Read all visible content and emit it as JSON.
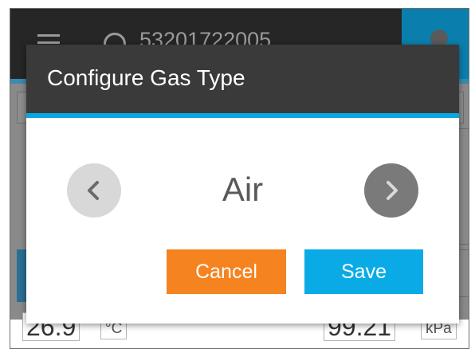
{
  "background": {
    "header": {
      "serial": "53201722005",
      "menu_icon": "hamburger-menu-icon",
      "info_icon": "info-circle-icon",
      "action_icon": "water-drop-icon"
    },
    "readings": {
      "temperature": {
        "value": "26.9",
        "unit": "°C"
      },
      "pressure": {
        "value": "99.21",
        "unit": "kPa"
      }
    }
  },
  "dialog": {
    "title": "Configure Gas Type",
    "selected_gas": "Air",
    "prev_icon": "chevron-left-icon",
    "next_icon": "chevron-right-icon",
    "cancel_label": "Cancel",
    "save_label": "Save"
  },
  "colors": {
    "dialog_header": "#3a3a3a",
    "accent_blue": "#0aa7de",
    "cancel_orange": "#f5831f",
    "save_blue": "#0aaae6"
  }
}
